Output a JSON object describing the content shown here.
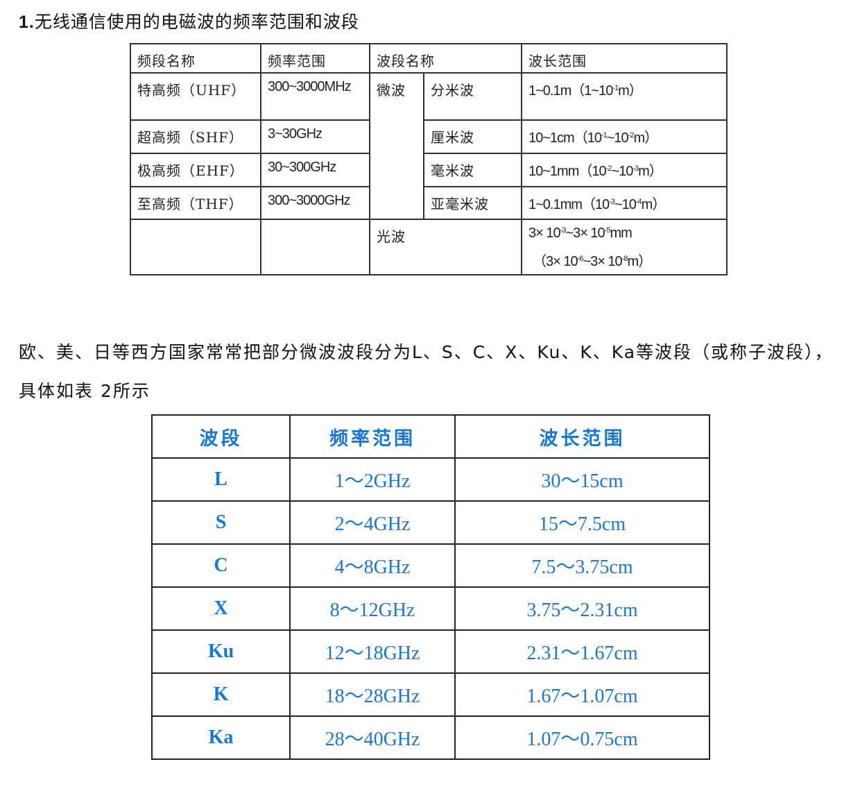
{
  "heading": {
    "number": "1.",
    "text": "无线通信使用的电磁波的频率范围和波段"
  },
  "table1": {
    "headers": [
      "频段名称",
      "频率范围",
      "波段名称",
      "波长范围"
    ],
    "rows": [
      {
        "band_name": "特高频（UHF）",
        "freq": "300~3000MHz",
        "wave_group": "微波",
        "wave_name": "分米波",
        "wavelength": "1~0.1m（1~10",
        "exp1": "-1",
        "tail1": "m）"
      },
      {
        "band_name": "超高频（SHF）",
        "freq": "3~30GHz",
        "wave_name": "厘米波",
        "wavelength": "10~1cm（10",
        "exp1": "-1",
        "mid": "~10",
        "exp2": "-2",
        "tail": "m）"
      },
      {
        "band_name": "极高频（EHF）",
        "freq": "30~300GHz",
        "wave_name": "毫米波",
        "wavelength": "10~1mm（10",
        "exp1": "-2",
        "mid": "~10",
        "exp2": "-3",
        "tail": "m）"
      },
      {
        "band_name": "至高频（THF）",
        "freq": "300~3000GHz",
        "wave_name": "亚毫米波",
        "wavelength": "1~0.1mm（10",
        "exp1": "-3",
        "mid": "~10",
        "exp2": "-4",
        "tail": "m）"
      },
      {
        "band_name": "",
        "freq": "",
        "wave_name": "光波",
        "line1": {
          "a": "3× 10",
          "e1": "-3",
          "b": "~3× 10",
          "e2": "-5",
          "c": "mm"
        },
        "line2": {
          "a": "（3× 10",
          "e1": "-6",
          "b": "~3× 10",
          "e2": "-8",
          "c": "m）"
        }
      }
    ]
  },
  "paragraph": "欧、美、日等西方国家常常把部分微波波段分为L、S、C、X、Ku、K、Ka等波段（或称子波段），具体如表 2所示",
  "table2": {
    "headers": [
      "波段",
      "频率范围",
      "波长范围"
    ],
    "rows": [
      [
        "L",
        "1～2GHz",
        "30～15cm"
      ],
      [
        "S",
        "2～4GHz",
        "15～7.5cm"
      ],
      [
        "C",
        "4～8GHz",
        "7.5～3.75cm"
      ],
      [
        "X",
        "8～12GHz",
        "3.75～2.31cm"
      ],
      [
        "Ku",
        "12～18GHz",
        "2.31～1.67cm"
      ],
      [
        "K",
        "18～28GHz",
        "1.67～1.07cm"
      ],
      [
        "Ka",
        "28～40GHz",
        "1.07～0.75cm"
      ]
    ]
  },
  "colors": {
    "table2_text": "#1976d2",
    "border": "#222222"
  }
}
